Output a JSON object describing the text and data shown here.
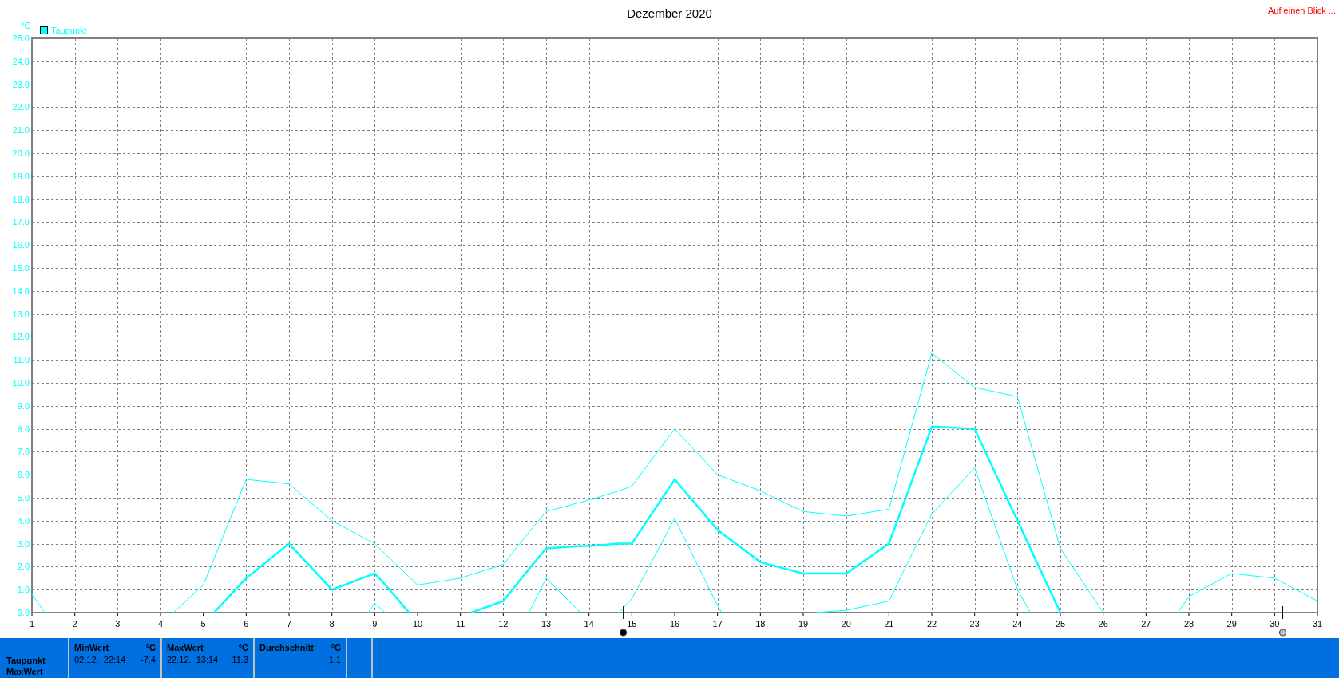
{
  "title": "Dezember 2020",
  "link": "Auf einen Blick ...",
  "chart": {
    "chart_data": {
      "type": "line",
      "grid": true,
      "ylabel": "°C",
      "x": [
        1,
        1.3,
        4.3,
        5,
        5.25,
        6,
        7,
        8,
        8.85,
        9,
        9.25,
        9.8,
        10,
        11,
        11.25,
        12,
        12.6,
        13,
        13.8,
        14,
        14.7,
        15,
        16,
        17,
        17.1,
        18,
        19,
        19.3,
        20,
        21,
        22,
        23,
        24,
        24.3,
        25,
        26,
        27.75,
        28,
        29,
        30,
        31
      ],
      "xlim": [
        1,
        31
      ],
      "ylim": [
        0,
        25
      ],
      "xticks": [
        1,
        2,
        3,
        4,
        5,
        6,
        7,
        8,
        9,
        10,
        11,
        12,
        13,
        14,
        15,
        16,
        17,
        18,
        19,
        20,
        21,
        22,
        23,
        24,
        25,
        26,
        27,
        28,
        29,
        30,
        31
      ],
      "yticks": [
        {
          "value": 0,
          "label": "0.0"
        },
        {
          "value": 1,
          "label": "1.0"
        },
        {
          "value": 2,
          "label": "2.0"
        },
        {
          "value": 3,
          "label": "3.0"
        },
        {
          "value": 4,
          "label": "4.0"
        },
        {
          "value": 5,
          "label": "5.0"
        },
        {
          "value": 6,
          "label": "6.0"
        },
        {
          "value": 7,
          "label": "7.0"
        },
        {
          "value": 8,
          "label": "8.0"
        },
        {
          "value": 9,
          "label": "9.0"
        },
        {
          "value": 10,
          "label": "10.0"
        },
        {
          "value": 11,
          "label": "11.0"
        },
        {
          "value": 12,
          "label": "12.0"
        },
        {
          "value": 13,
          "label": "13.0"
        },
        {
          "value": 14,
          "label": "14.0"
        },
        {
          "value": 15,
          "label": "15.0"
        },
        {
          "value": 16,
          "label": "16.0"
        },
        {
          "value": 17,
          "label": "17.0"
        },
        {
          "value": 18,
          "label": "18.0"
        },
        {
          "value": 19,
          "label": "19.0"
        },
        {
          "value": 20,
          "label": "20.0"
        },
        {
          "value": 21,
          "label": "21.0"
        },
        {
          "value": 22,
          "label": "22.0"
        },
        {
          "value": 23,
          "label": "23.0"
        },
        {
          "value": 24,
          "label": "24.0"
        },
        {
          "value": 25,
          "label": "25.0"
        }
      ],
      "series": [
        {
          "color": "#00ffff",
          "values": [
            0.8,
            0,
            0,
            1.2,
            2.35,
            5.8,
            5.6,
            4.0,
            3.15,
            3.0,
            2.55,
            1.56,
            1.2,
            1.5,
            1.65,
            2.1,
            3.5,
            4.4,
            4.8,
            4.9,
            5.3,
            5.5,
            8.0,
            6.0,
            5.93,
            5.3,
            4.4,
            4.34,
            4.2,
            4.5,
            11.3,
            9.8,
            9.4,
            7.4,
            2.8,
            0,
            0,
            0.7,
            1.7,
            1.5,
            0.5
          ]
        },
        {
          "color": "#00ffff",
          "values": [
            null,
            null,
            null,
            null,
            0,
            1.5,
            3.0,
            1.0,
            1.6,
            1.7,
            1.2,
            0,
            null,
            null,
            0,
            0.5,
            1.9,
            2.8,
            2.9,
            2.9,
            3.0,
            3.0,
            5.8,
            3.6,
            3.46,
            2.2,
            1.7,
            1.7,
            1.7,
            3.0,
            8.1,
            8.0,
            4.0,
            2.8,
            0,
            null,
            null,
            null,
            null,
            null,
            null
          ]
        },
        {
          "color": "#00ffff",
          "values": [
            null,
            null,
            null,
            null,
            null,
            null,
            null,
            null,
            0,
            0.4,
            0,
            null,
            null,
            null,
            null,
            null,
            0,
            1.5,
            0,
            null,
            0,
            0.6,
            4.1,
            0.3,
            0,
            null,
            null,
            0,
            0.1,
            0.5,
            4.3,
            6.3,
            1.0,
            0,
            null,
            null,
            null,
            null,
            null,
            null,
            null
          ]
        }
      ]
    },
    "moon_markers": [
      {
        "kind": "new_moon",
        "level": 0.46
      },
      {
        "kind": "full_moon",
        "level": 0.973
      }
    ]
  },
  "legend": [
    {
      "label": "Taupunkt",
      "color": "#00ffff"
    }
  ],
  "stats": {
    "row_labels": [
      "Taupunkt",
      "MaxWert"
    ],
    "columns": [
      {
        "heading": "MinWert",
        "unit": "°C",
        "date": "02.12.",
        "time": "22:14",
        "value": "-7.4"
      },
      {
        "heading": "MaxWert",
        "unit": "°C",
        "date": "22.12.",
        "time": "13:14",
        "value": "11.3"
      },
      {
        "heading": "Durchschnitt",
        "unit": "°C",
        "value": "1.1"
      }
    ]
  }
}
